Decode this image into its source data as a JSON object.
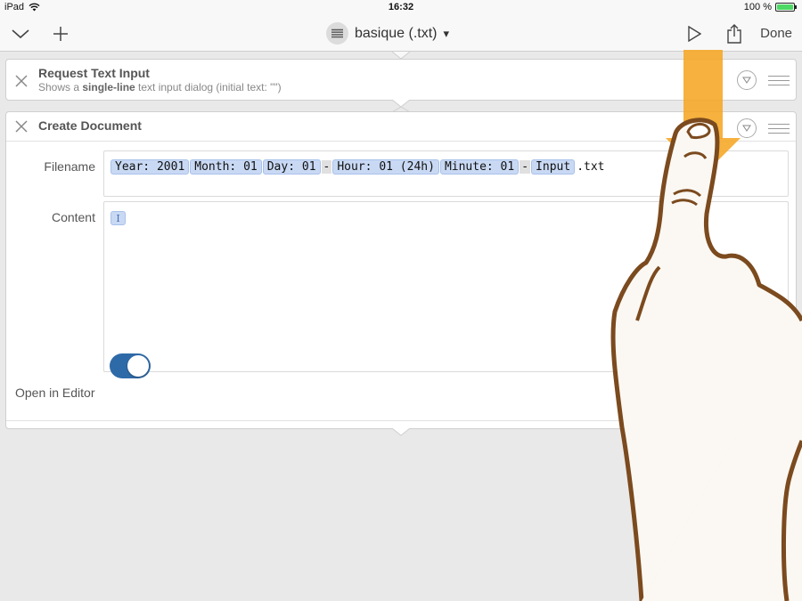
{
  "status_bar": {
    "device": "iPad",
    "time": "16:32",
    "battery": "100 %",
    "battery_level": 1.0
  },
  "nav": {
    "title": "basique (.txt)",
    "title_caret": "▾",
    "done_label": "Done"
  },
  "actions": [
    {
      "title": "Request Text Input",
      "subtitle_prefix": "Shows a ",
      "subtitle_bold": "single-line",
      "subtitle_suffix": " text input dialog (initial text: \"\")"
    },
    {
      "title": "Create Document",
      "filename_label": "Filename",
      "filename_tokens": [
        "Year: 2001",
        "Month: 01",
        "Day: 01",
        "-",
        "Hour: 01 (24h)",
        "Minute: 01",
        "-",
        "Input"
      ],
      "filename_suffix": ".txt",
      "content_label": "Content",
      "content_token": "I",
      "open_in_editor_label": "Open in Editor",
      "open_in_editor": true
    }
  ],
  "colors": {
    "accent": "#2f6aa8",
    "token_bg": "#c9d9f4",
    "gesture_arrow": "#f5a623",
    "hand_outline": "#7b4a1e"
  },
  "icons": [
    "chevron-down-icon",
    "plus-icon",
    "list-icon",
    "play-icon",
    "share-icon",
    "close-icon",
    "options-icon",
    "drag-handle-icon",
    "wifi-icon",
    "battery-icon",
    "swipe-down-arrow",
    "hand-gesture"
  ]
}
